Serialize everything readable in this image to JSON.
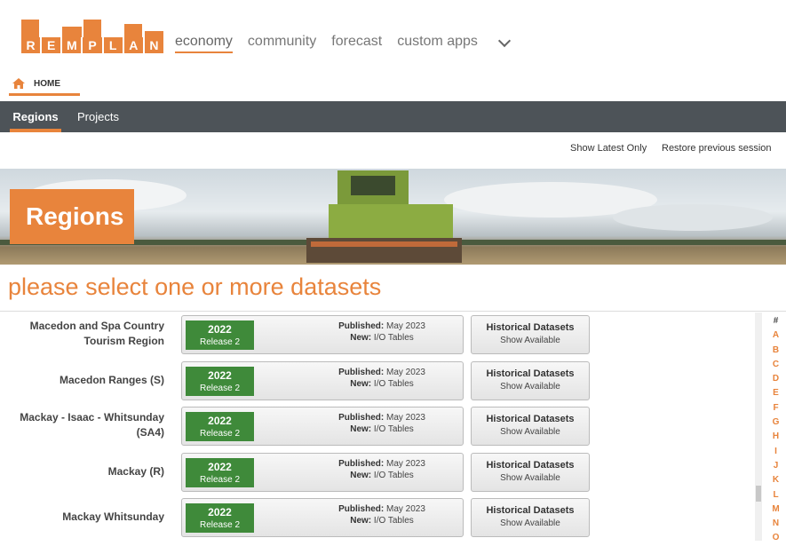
{
  "logo": {
    "letters": [
      "R",
      "E",
      "M",
      "P",
      "L",
      "A",
      "N"
    ]
  },
  "nav": {
    "items": [
      "economy",
      "community",
      "forecast",
      "custom apps"
    ],
    "active": "economy"
  },
  "breadcrumb": {
    "home": "HOME"
  },
  "subnav": {
    "tabs": [
      "Regions",
      "Projects"
    ],
    "active": "Regions"
  },
  "top_links": {
    "latest": "Show Latest Only",
    "restore": "Restore previous session"
  },
  "banner": {
    "title": "Regions"
  },
  "prompt": "please select one or more datasets",
  "dataset_labels": {
    "published": "Published:",
    "new": "New:",
    "hist_title": "Historical Datasets",
    "hist_sub": "Show Available"
  },
  "rows": [
    {
      "name": "Macedon and Spa Country Tourism Region",
      "year": "2022",
      "release": "Release 2",
      "published": "May 2023",
      "new": "I/O Tables"
    },
    {
      "name": "Macedon Ranges (S)",
      "year": "2022",
      "release": "Release 2",
      "published": "May 2023",
      "new": "I/O Tables"
    },
    {
      "name": "Mackay - Isaac - Whitsunday (SA4)",
      "year": "2022",
      "release": "Release 2",
      "published": "May 2023",
      "new": "I/O Tables"
    },
    {
      "name": "Mackay (R)",
      "year": "2022",
      "release": "Release 2",
      "published": "May 2023",
      "new": "I/O Tables"
    },
    {
      "name": "Mackay Whitsunday",
      "year": "2022",
      "release": "Release 2",
      "published": "May 2023",
      "new": "I/O Tables"
    }
  ],
  "alphabet": [
    "#",
    "A",
    "B",
    "C",
    "D",
    "E",
    "F",
    "G",
    "H",
    "I",
    "J",
    "K",
    "L",
    "M",
    "N",
    "O"
  ],
  "colors": {
    "accent": "#e8843c",
    "release_green": "#3f8a3a",
    "subnav_bg": "#4d5358"
  }
}
